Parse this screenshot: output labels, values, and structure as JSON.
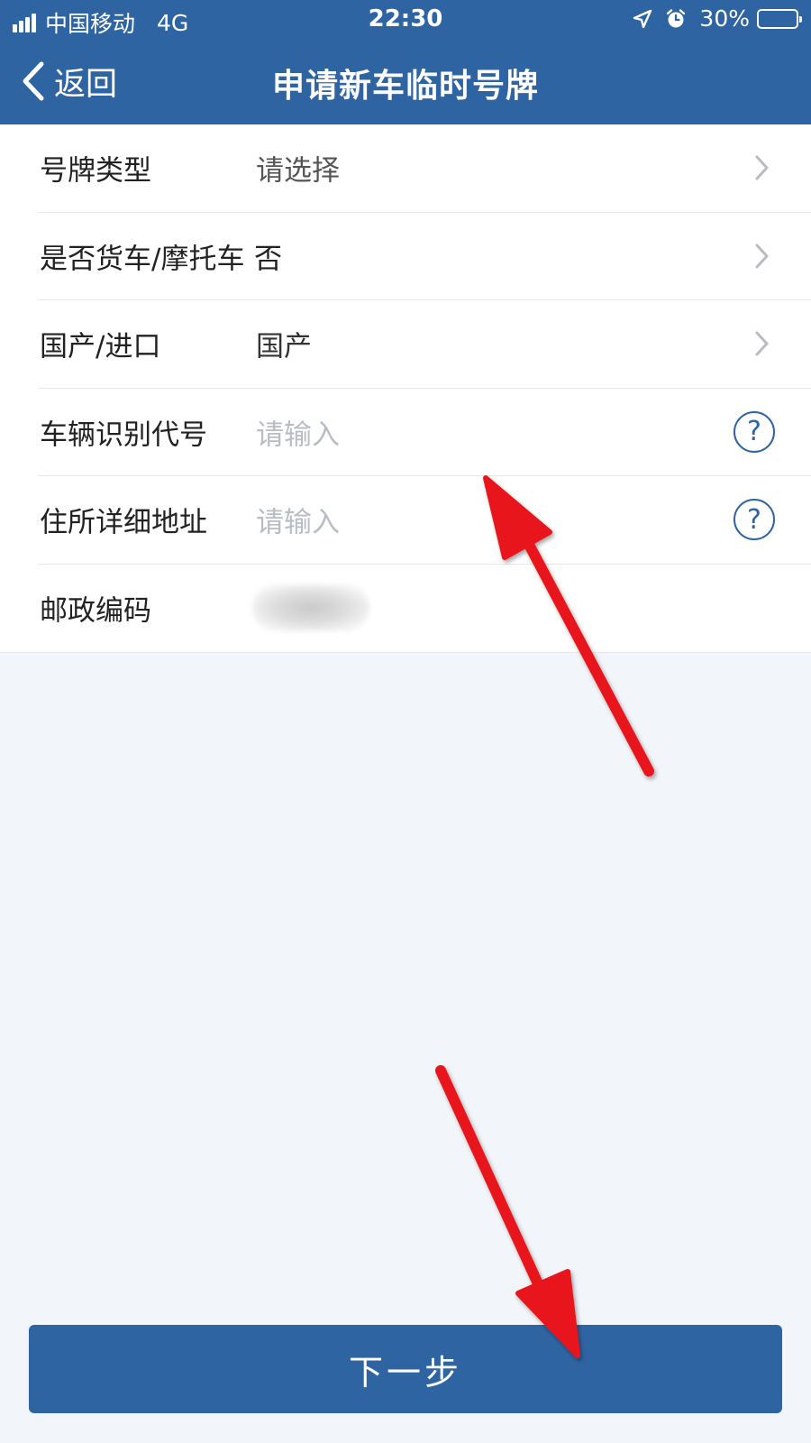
{
  "status_bar": {
    "carrier": "中国移动",
    "network": "4G",
    "time": "22:30",
    "battery": "30%",
    "battery_level": 0.3
  },
  "nav": {
    "back_label": "返回",
    "title": "申请新车临时号牌"
  },
  "form": {
    "rows": [
      {
        "label": "号牌类型",
        "value": "请选择",
        "control": "chevron"
      },
      {
        "label": "是否货车/摩托车",
        "value": "否",
        "control": "chevron"
      },
      {
        "label": "国产/进口",
        "value": "国产",
        "control": "chevron"
      },
      {
        "label": "车辆识别代号",
        "placeholder": "请输入",
        "control": "help"
      },
      {
        "label": "住所详细地址",
        "placeholder": "请输入",
        "control": "help"
      },
      {
        "label": "邮政编码",
        "control": "blurred"
      }
    ]
  },
  "help_icon_glyph": "?",
  "next_button": {
    "label": "下一步"
  },
  "colors": {
    "primary": "#2f64a3",
    "annotation_arrow": "#e8151b"
  }
}
